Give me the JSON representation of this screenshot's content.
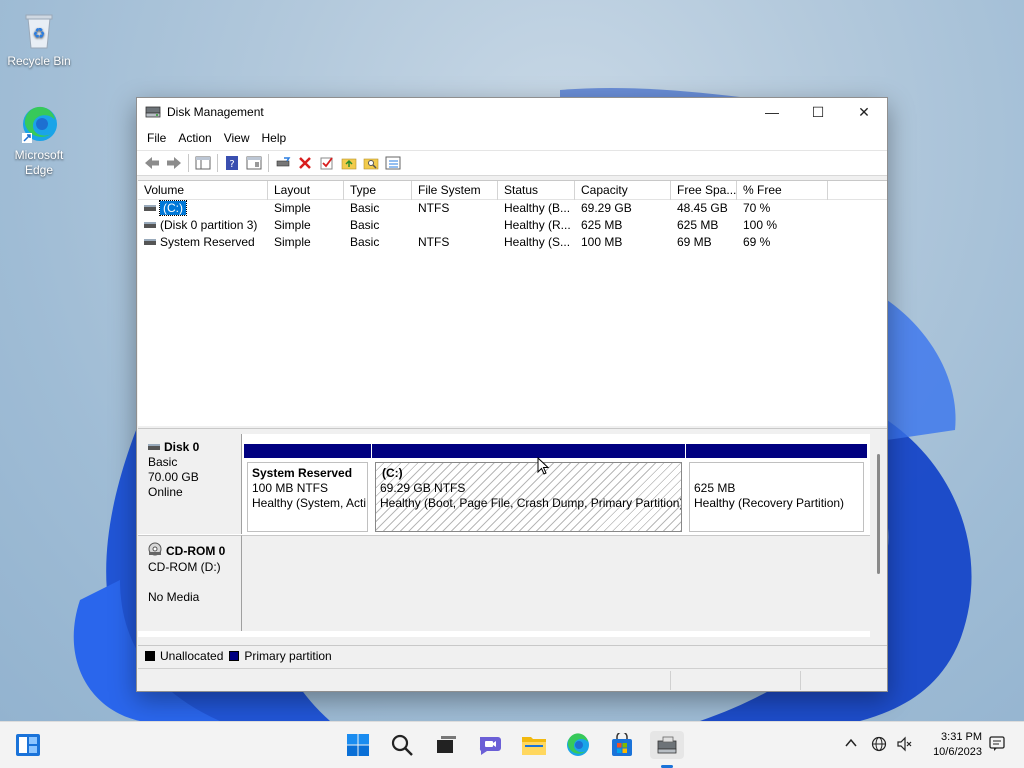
{
  "desktop": {
    "icons": [
      {
        "label": "Recycle Bin"
      },
      {
        "label": "Microsoft Edge"
      }
    ]
  },
  "window": {
    "title": "Disk Management",
    "controls": {
      "minimize": "—",
      "maximize": "☐",
      "close": "✕"
    }
  },
  "menu": [
    "File",
    "Action",
    "View",
    "Help"
  ],
  "volumes": {
    "columns": [
      "Volume",
      "Layout",
      "Type",
      "File System",
      "Status",
      "Capacity",
      "Free Spa...",
      "% Free"
    ],
    "rows": [
      {
        "volume": "(C:)",
        "layout": "Simple",
        "type": "Basic",
        "fs": "NTFS",
        "status": "Healthy (B...",
        "capacity": "69.29 GB",
        "free": "48.45 GB",
        "pct": "70 %"
      },
      {
        "volume": "(Disk 0 partition 3)",
        "layout": "Simple",
        "type": "Basic",
        "fs": "",
        "status": "Healthy (R...",
        "capacity": "625 MB",
        "free": "625 MB",
        "pct": "100 %"
      },
      {
        "volume": "System Reserved",
        "layout": "Simple",
        "type": "Basic",
        "fs": "NTFS",
        "status": "Healthy (S...",
        "capacity": "100 MB",
        "free": "69 MB",
        "pct": "69 %"
      }
    ]
  },
  "disk0": {
    "name": "Disk 0",
    "type": "Basic",
    "size": "70.00 GB",
    "state": "Online",
    "partitions": [
      {
        "title": "System Reserved",
        "size": "100 MB NTFS",
        "status": "Healthy (System, Acti"
      },
      {
        "title": "(C:)",
        "size": "69.29 GB NTFS",
        "status": "Healthy (Boot, Page File, Crash Dump, Primary Partition)"
      },
      {
        "title": "",
        "size": "625 MB",
        "status": "Healthy (Recovery Partition)"
      }
    ]
  },
  "cdrom": {
    "name": "CD-ROM 0",
    "drive": "CD-ROM (D:)",
    "media": "No Media"
  },
  "legend": {
    "unallocated": "Unallocated",
    "primary": "Primary partition",
    "colors": {
      "unallocated": "#000000",
      "primary": "#000080"
    }
  },
  "taskbar": {
    "time": "3:31 PM",
    "date": "10/6/2023"
  }
}
